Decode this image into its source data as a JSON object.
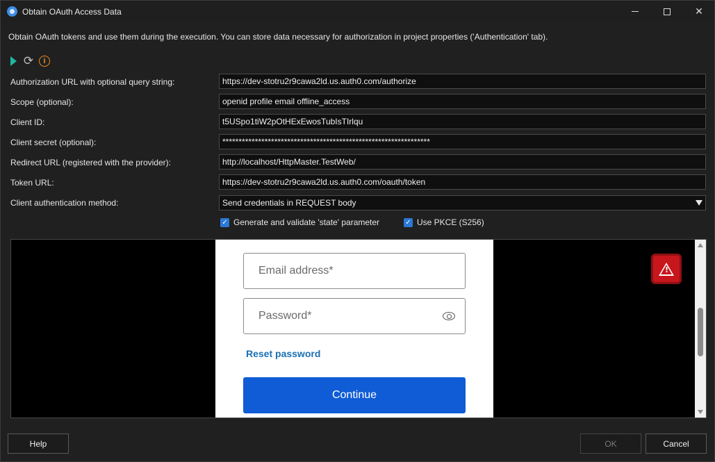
{
  "window": {
    "title": "Obtain OAuth Access Data",
    "description": "Obtain OAuth tokens and use them during the execution. You can store data necessary for authorization in project properties ('Authentication' tab)."
  },
  "toolbar": {
    "icons": [
      "play-icon",
      "refresh-icon",
      "info-icon"
    ],
    "info_glyph": "i"
  },
  "form": {
    "auth_url_label": "Authorization URL with optional query string:",
    "auth_url_value": "https://dev-stotru2r9cawa2ld.us.auth0.com/authorize",
    "scope_label": "Scope (optional):",
    "scope_value": "openid profile email offline_access",
    "client_id_label": "Client ID:",
    "client_id_value": "t5USpo1tiW2pOtHExEwosTubIsTIrlqu",
    "client_secret_label": "Client secret (optional):",
    "client_secret_value": "****************************************************************",
    "redirect_url_label": "Redirect URL (registered with the provider):",
    "redirect_url_value": "http://localhost/HttpMaster.TestWeb/",
    "token_url_label": "Token URL:",
    "token_url_value": "https://dev-stotru2r9cawa2ld.us.auth0.com/oauth/token",
    "client_auth_method_label": "Client authentication method:",
    "client_auth_method_value": "Send credentials in REQUEST body",
    "state_checkbox_label": "Generate and validate 'state' parameter",
    "state_checked": true,
    "pkce_checkbox_label": "Use PKCE (S256)",
    "pkce_checked": true
  },
  "browser": {
    "email_placeholder": "Email address*",
    "password_placeholder": "Password*",
    "reset_password_label": "Reset password",
    "continue_label": "Continue"
  },
  "buttons": {
    "help": "Help",
    "ok": "OK",
    "cancel": "Cancel"
  },
  "colors": {
    "accent": "#2b78d6",
    "play": "#1fb8a0",
    "info": "#f08a24",
    "continue": "#0f5cd6",
    "warning": "#c8161d",
    "link": "#1a6fb3"
  }
}
